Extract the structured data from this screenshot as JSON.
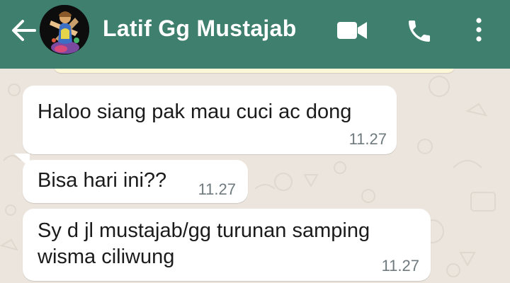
{
  "header": {
    "contact_name": "Latif Gg Mustajab",
    "background_color": "#3f7f6d",
    "icons": [
      "arrow-left-icon",
      "video-camera-icon",
      "phone-icon",
      "more-vertical-icon"
    ]
  },
  "chat": {
    "wallpaper_color": "#ece5dd",
    "bubble_color": "#ffffff",
    "messages": [
      {
        "lines": [
          "Haloo siang pak mau cuci ac dong"
        ],
        "time": "11.27"
      },
      {
        "lines": [
          "Bisa hari ini??"
        ],
        "time": "11.27"
      },
      {
        "lines": [
          "Sy d jl mustajab/gg turunan samping",
          "wisma ciliwung"
        ],
        "time": "11.27"
      }
    ]
  }
}
